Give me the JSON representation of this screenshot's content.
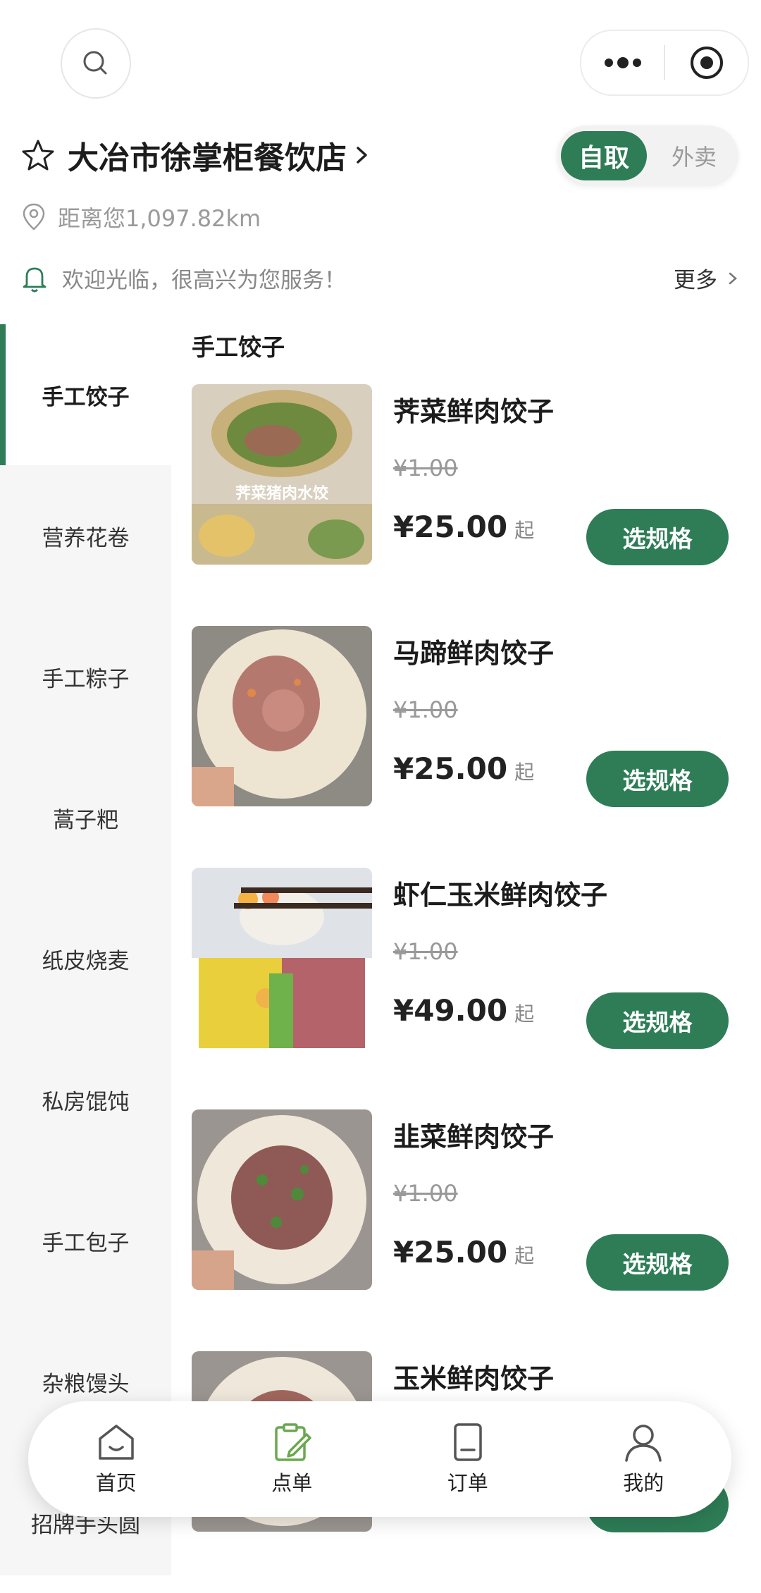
{
  "topbar": {
    "icons": [
      "search-icon",
      "more-dots-icon",
      "target-icon"
    ]
  },
  "store": {
    "name": "大冶市徐掌柜餐饮店",
    "distance": "距离您1,097.82km",
    "notice": "欢迎光临，很高兴为您服务！",
    "more_label": "更多",
    "mode_pickup": "自取",
    "mode_delivery": "外卖"
  },
  "sidebar": {
    "items": [
      {
        "label": "手工饺子",
        "active": true
      },
      {
        "label": "营养花卷"
      },
      {
        "label": "手工粽子"
      },
      {
        "label": "蒿子粑"
      },
      {
        "label": "纸皮烧麦"
      },
      {
        "label": "私房馄饨"
      },
      {
        "label": "手工包子"
      },
      {
        "label": "杂粮馒头"
      },
      {
        "label": "招牌手头圆"
      }
    ]
  },
  "section_title": "手工饺子",
  "products": [
    {
      "name": "荠菜鲜肉饺子",
      "original_price": "¥1.00",
      "price": "¥25.00",
      "from": "起",
      "button": "选规格",
      "image_caption": "荠菜猪肉水饺"
    },
    {
      "name": "马蹄鲜肉饺子",
      "original_price": "¥1.00",
      "price": "¥25.00",
      "from": "起",
      "button": "选规格"
    },
    {
      "name": "虾仁玉米鲜肉饺子",
      "original_price": "¥1.00",
      "price": "¥49.00",
      "from": "起",
      "button": "选规格"
    },
    {
      "name": "韭菜鲜肉饺子",
      "original_price": "¥1.00",
      "price": "¥25.00",
      "from": "起",
      "button": "选规格"
    },
    {
      "name": "玉米鲜肉饺子"
    }
  ],
  "bottom_nav": [
    {
      "label": "首页",
      "icon": "home-icon"
    },
    {
      "label": "点单",
      "icon": "order-pad-icon",
      "active": true
    },
    {
      "label": "订单",
      "icon": "receipt-icon"
    },
    {
      "label": "我的",
      "icon": "user-icon"
    }
  ],
  "colors": {
    "accent": "#2e7d57",
    "nav_active": "#6aa84f"
  }
}
